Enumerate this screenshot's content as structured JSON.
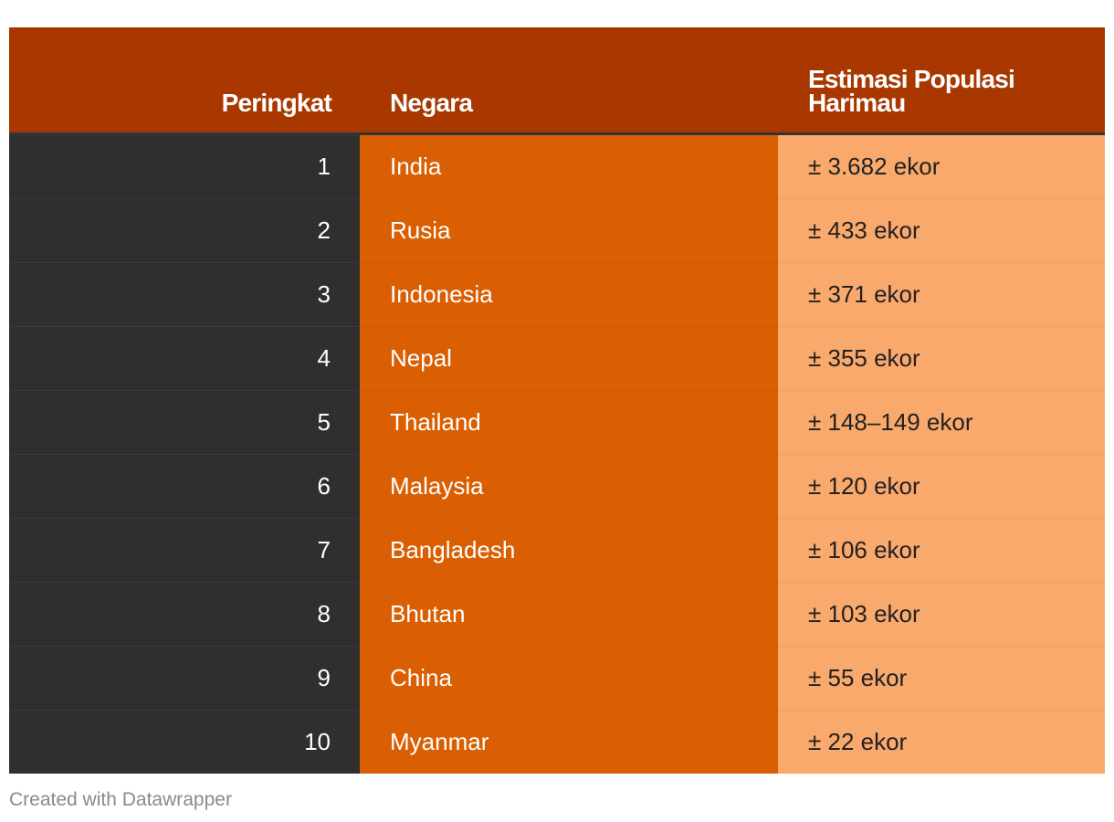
{
  "chart_data": {
    "type": "table",
    "columns": [
      "Peringkat",
      "Negara",
      "Estimasi Populasi Harimau"
    ],
    "rows": [
      {
        "rank": "1",
        "country": "India",
        "population": "± 3.682 ekor"
      },
      {
        "rank": "2",
        "country": "Rusia",
        "population": "± 433 ekor"
      },
      {
        "rank": "3",
        "country": "Indonesia",
        "population": "± 371 ekor"
      },
      {
        "rank": "4",
        "country": "Nepal",
        "population": "± 355 ekor"
      },
      {
        "rank": "5",
        "country": "Thailand",
        "population": "± 148–149 ekor"
      },
      {
        "rank": "6",
        "country": "Malaysia",
        "population": "± 120 ekor"
      },
      {
        "rank": "7",
        "country": "Bangladesh",
        "population": "± 106 ekor"
      },
      {
        "rank": "8",
        "country": "Bhutan",
        "population": "± 103 ekor"
      },
      {
        "rank": "9",
        "country": "China",
        "population": "± 55 ekor"
      },
      {
        "rank": "10",
        "country": "Myanmar",
        "population": "± 22 ekor"
      }
    ]
  },
  "colors": {
    "header": "#a83800",
    "rank_column": "#2f2f2f",
    "country_column": "#d95f02",
    "population_column": "#f9a96b"
  },
  "footer": {
    "credit": "Created with Datawrapper"
  }
}
